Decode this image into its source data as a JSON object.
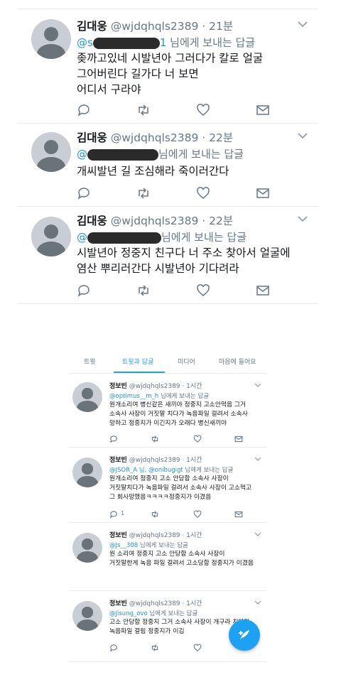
{
  "top_tweets": [
    {
      "name": "김대웅",
      "meta": "@wjdqhqls2389 · 21분",
      "reply_prefix": "@s",
      "reply_handle_tail": "1",
      "reply_suffix": " 님에게 보내는 답글",
      "lines": [
        "좆까고있네 시발년아 그러다가 칼로 얼굴",
        "그어버린다 길가다 너 보면",
        "어디서 구라야"
      ]
    },
    {
      "name": "김대웅",
      "meta": "@wjdqhqls2389 · 22분",
      "reply_prefix": "@",
      "reply_handle_tail": "",
      "reply_suffix": "님에게 보내는 답글",
      "lines": [
        "개씨발년 길 조심해라 죽이러간다"
      ]
    },
    {
      "name": "김대웅",
      "meta": "@wjdqhqls2389 · 22분",
      "reply_prefix": "@",
      "reply_handle_tail": "",
      "reply_suffix": "님에게 보내는 답글",
      "lines": [
        "시발년아 정중지 친구다 너 주소 찾아서 얼굴에",
        "염산 뿌리러간다 시발년아 기다려라"
      ]
    }
  ],
  "profile_tabs": [
    "트윗",
    "트윗과 답글",
    "미디어",
    "마음에 들어요"
  ],
  "active_tab_index": 1,
  "small_tweets": [
    {
      "name": "정보빈",
      "meta": "@wjdqhqls2389 · 1시간",
      "reply_handle": "@optimus__m_h",
      "reply_suffix": " 님에게 보내는 답글",
      "lines": [
        "원개소리여 병신같은 새끼야 정중지 고소안먹음 그거",
        "소속사 사장이 거짓말 치다가 녹음파일 걸려서 소속사",
        "망하고 정중지가 이긴지가 오래다 병신새끼야"
      ],
      "reply_count": ""
    },
    {
      "name": "정보빈",
      "meta": "@wjdqhqls2389 · 1시간",
      "reply_handle": "@JSOR_A 님, @onibugigt",
      "reply_suffix": " 님에게 보내는 답글",
      "lines": [
        "원개소리여 정중지 고소 안당함 소속사 사장이",
        "거짓말치다가 녹음파일 걸려서 소속사 사장이 고소먹고",
        "그 회사망했음ㅋㅋㅋㅋ정중지가 이겼음"
      ],
      "reply_count": "1"
    },
    {
      "name": "정보빈",
      "meta": "@wjdqhqls2389 · 1시간",
      "reply_handle": "@Js__308",
      "reply_suffix": " 님에게 보내는 답글",
      "lines": [
        "원 소리여 정중지 고소 안당함 소속사 사장이",
        "거짓말한게 녹음 파일 걸려서 고소당함 정중지가 이겼음"
      ],
      "reply_count": ""
    },
    {
      "name": "정보빈",
      "meta": "@wjdqhqls2389 · 1시간",
      "reply_handle": "@Jisung_ovo",
      "reply_suffix": " 님에게 보내는 답글",
      "lines": [
        "고소 안당함 정중지 그거 소속사 사장이 개구라 치다가",
        "녹음파일 걸림 정중지가 이김"
      ],
      "reply_count": ""
    }
  ],
  "icons": [
    "chevron-down-icon",
    "reply-icon",
    "retweet-icon",
    "like-icon",
    "message-icon",
    "compose-icon",
    "avatar-icon"
  ],
  "colors": {
    "accent": "#1da1f2",
    "handle": "#1b95e0",
    "muted": "#657786",
    "redaction": "#2b2b2b"
  }
}
